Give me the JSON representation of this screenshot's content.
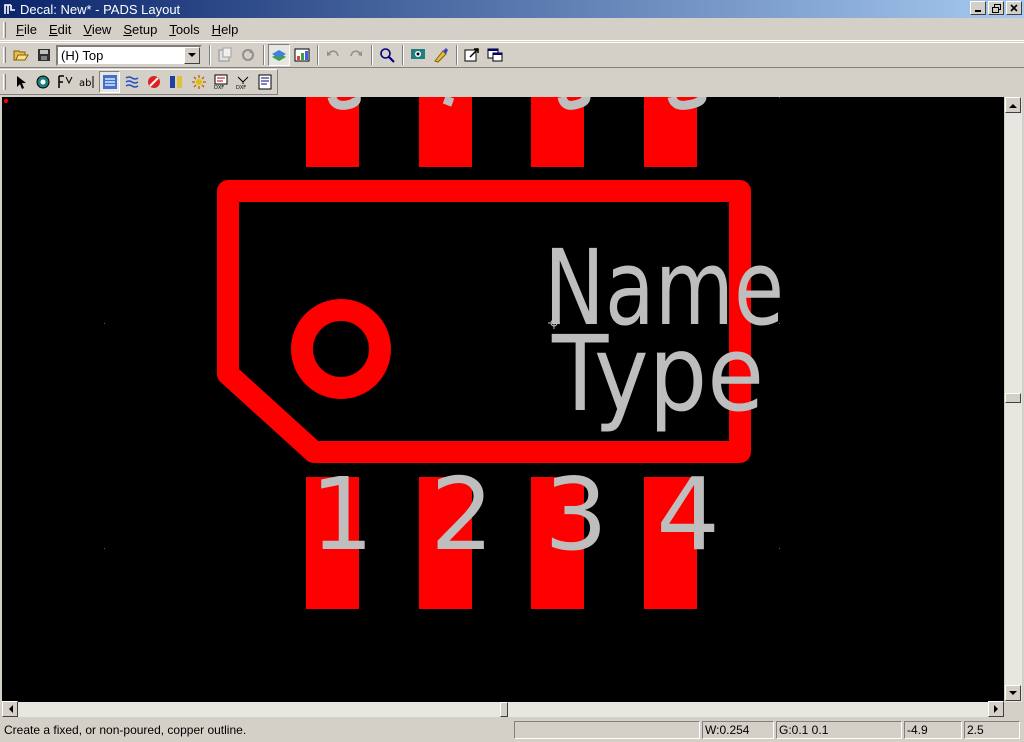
{
  "window": {
    "title": "Decal: New* - PADS Layout"
  },
  "menu": [
    {
      "label": "File",
      "accel": "F",
      "rest": "ile"
    },
    {
      "label": "Edit",
      "accel": "E",
      "rest": "dit"
    },
    {
      "label": "View",
      "accel": "V",
      "rest": "iew"
    },
    {
      "label": "Setup",
      "accel": "S",
      "rest": "etup"
    },
    {
      "label": "Tools",
      "accel": "T",
      "rest": "ools"
    },
    {
      "label": "Help",
      "accel": "H",
      "rest": "elp"
    }
  ],
  "toolbar": {
    "layer_selected": "(H) Top"
  },
  "canvas": {
    "pin_labels": [
      "1",
      "2",
      "3",
      "4"
    ],
    "name_label": "Name",
    "type_label": "Type",
    "colors": {
      "background": "#000000",
      "copper": "#ff0000",
      "text": "#bebebe"
    }
  },
  "status": {
    "message": "Create a fixed, or non-poured, copper outline.",
    "width": "W:0.254",
    "grid": "G:0.1 0.1",
    "x": "-4.9",
    "y": "2.5"
  }
}
